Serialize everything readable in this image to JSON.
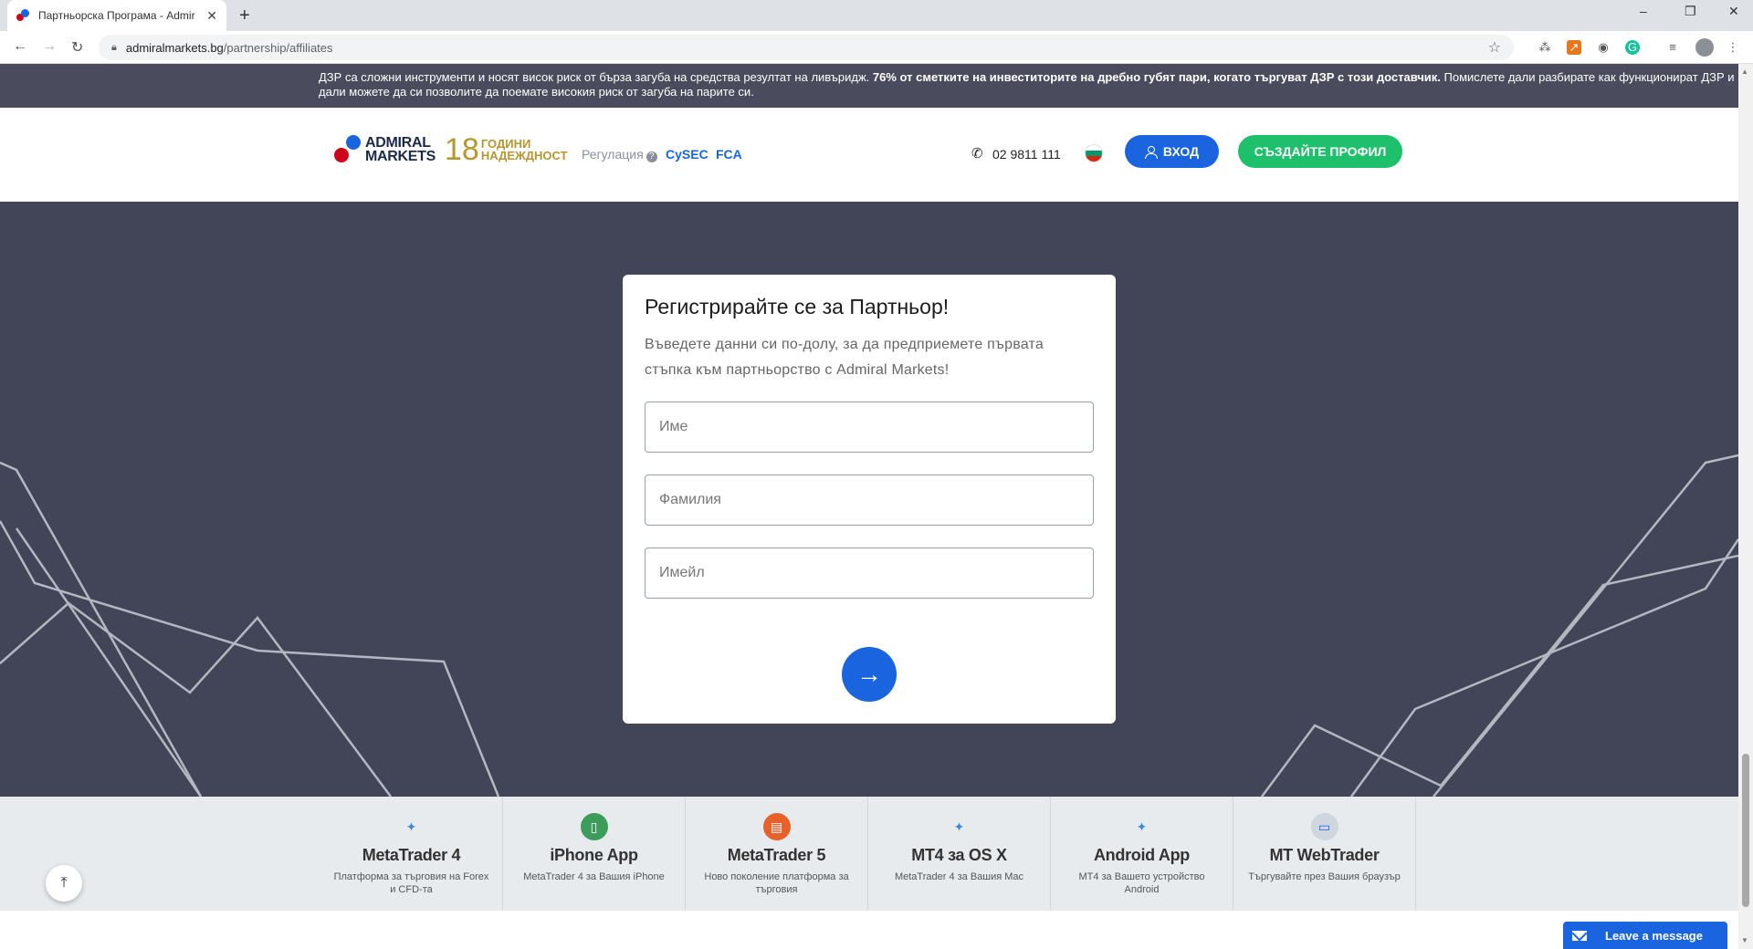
{
  "browser": {
    "tab_title": "Партньорска Програма - Admir",
    "tab_close": "✕",
    "new_tab": "+",
    "url_host": "admiralmarkets.bg",
    "url_path": "/partnership/affiliates",
    "controls": {
      "minimize": "–",
      "restore": "❐",
      "close": "✕"
    }
  },
  "risk_banner": {
    "text_normal_1": "ДЗР са сложни инструменти и носят висок риск от бърза загуба на средства резултат на ливъридж. ",
    "text_bold": "76% от сметките на инвеститорите на дребно губят пари, когато търгуват ДЗР с този доставчик.",
    "text_normal_2": " Помислете дали разбирате как функционират ДЗР и дали можете да си позволите да поемате високия риск от загуба на парите си."
  },
  "header": {
    "logo_line1": "ADMIRAL",
    "logo_line2": "MARKETS",
    "logo_years": "18",
    "logo_years_line1": "ГОДИНИ",
    "logo_years_line2": "НАДЕЖДНОСТ",
    "regulation_label": "Регулация",
    "regulation_links": [
      "CySEC",
      "FCA"
    ],
    "phone": "02 9811 111",
    "login_label": "ВХОД",
    "signup_label": "СЪЗДАЙТЕ ПРОФИЛ"
  },
  "form": {
    "title": "Регистрирайте се за Партньор!",
    "description": "Въведете данни си по-долу, за да предприемете първата стъпка към партньорство с Admiral Markets!",
    "fields": [
      {
        "placeholder": "Име",
        "value": ""
      },
      {
        "placeholder": "Фамилия",
        "value": ""
      },
      {
        "placeholder": "Имейл",
        "value": ""
      }
    ],
    "submit_icon": "arrow-right-icon"
  },
  "platforms": [
    {
      "name": "MetaTrader 4",
      "desc": "Платформа за търговия на Forex и CFD-та"
    },
    {
      "name": "iPhone App",
      "desc": "MetaTrader 4 за Вашия iPhone"
    },
    {
      "name": "MetaTrader 5",
      "desc": "Ново поколение платформа за търговия"
    },
    {
      "name": "MT4 за OS X",
      "desc": "MetaTrader 4 за Вашия Mac"
    },
    {
      "name": "Android App",
      "desc": "MT4 за Вашето устройство Android"
    },
    {
      "name": "MT WebTrader",
      "desc": "Търгувайте през Вашия браузър"
    }
  ],
  "chat": {
    "label": "Leave a message"
  },
  "colors": {
    "brand_blue": "#1a64e0",
    "brand_green": "#1fc06b",
    "hero_bg": "#424557",
    "banner_bg": "#4a4c5e"
  }
}
